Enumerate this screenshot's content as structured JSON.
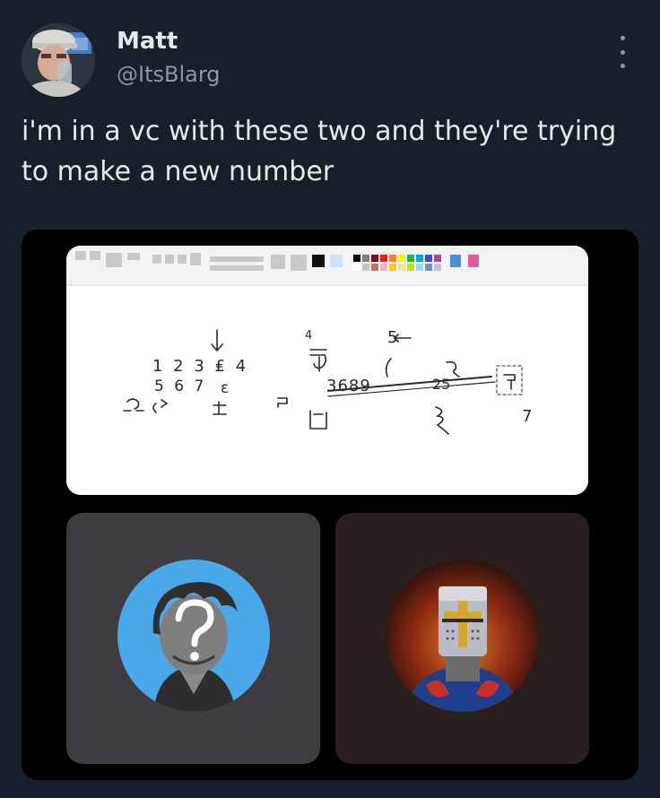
{
  "tweet": {
    "author_name": "Matt",
    "author_handle": "@ItsBlarg",
    "text": "i'm in a vc with these two and they're trying to make a new number"
  },
  "icons": {
    "more": "more-vertical-icon"
  },
  "image": {
    "paint_canvas": {
      "drawn_characters": [
        "4",
        "5",
        "←",
        "↓",
        "1 2 3 £ 4",
        "5 6 7",
        "∃",
        "С",
        "Ɔ",
        "Ƨ",
        "3689",
        "Ω",
        "⌐",
        "Ɛ",
        "∀",
        "ʃ",
        "Ƶ",
        "7"
      ]
    },
    "participants": [
      {
        "name": "participant-1",
        "bg_color": "#3f3c41"
      },
      {
        "name": "participant-2",
        "bg_color": "#2b1e1e"
      }
    ]
  },
  "colors": {
    "background": "#15202b",
    "text_primary": "#e7e9ea",
    "text_secondary": "#8b98a5"
  }
}
